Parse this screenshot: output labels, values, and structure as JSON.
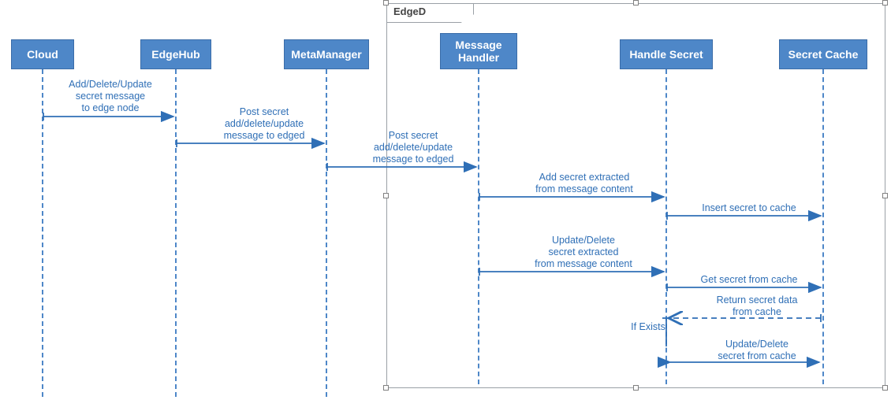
{
  "frame": {
    "label": "EdgeD"
  },
  "participants": {
    "cloud": {
      "label": "Cloud"
    },
    "edgehub": {
      "label": "EdgeHub"
    },
    "metamanager": {
      "label": "MetaManager"
    },
    "messagehandler": {
      "label": "Message\nHandler"
    },
    "handlesecret": {
      "label": "Handle Secret"
    },
    "secretcache": {
      "label": "Secret Cache"
    }
  },
  "messages": {
    "m1": "Add/Delete/Update\nsecret message\nto edge node",
    "m2": "Post secret\nadd/delete/update\nmessage to edged",
    "m3": "Post secret\nadd/delete/update\nmessage to edged",
    "m4": "Add secret extracted\nfrom message content",
    "m5": "Insert secret to cache",
    "m6": "Update/Delete\nsecret extracted\nfrom message content",
    "m7": "Get secret from cache",
    "m8": "Return secret data\nfrom cache",
    "m9": "If Exists",
    "m10": "Update/Delete\nsecret from cache"
  },
  "chart_data": {
    "type": "sequence-diagram",
    "frame": "EdgeD",
    "participants": [
      "Cloud",
      "EdgeHub",
      "MetaManager",
      "Message Handler",
      "Handle Secret",
      "Secret Cache"
    ],
    "frame_participants": [
      "Message Handler",
      "Handle Secret",
      "Secret Cache"
    ],
    "messages": [
      {
        "from": "Cloud",
        "to": "EdgeHub",
        "label": "Add/Delete/Update secret message to edge node",
        "style": "solid"
      },
      {
        "from": "EdgeHub",
        "to": "MetaManager",
        "label": "Post secret add/delete/update message to edged",
        "style": "solid"
      },
      {
        "from": "MetaManager",
        "to": "Message Handler",
        "label": "Post secret add/delete/update message to edged",
        "style": "solid"
      },
      {
        "from": "Message Handler",
        "to": "Handle Secret",
        "label": "Add secret extracted from message content",
        "style": "solid"
      },
      {
        "from": "Handle Secret",
        "to": "Secret Cache",
        "label": "Insert secret to cache",
        "style": "solid"
      },
      {
        "from": "Message Handler",
        "to": "Handle Secret",
        "label": "Update/Delete secret extracted from message content",
        "style": "solid"
      },
      {
        "from": "Handle Secret",
        "to": "Secret Cache",
        "label": "Get secret from cache",
        "style": "solid"
      },
      {
        "from": "Secret Cache",
        "to": "Handle Secret",
        "label": "Return secret data from cache",
        "style": "dashed"
      },
      {
        "from": "Handle Secret",
        "to": "Handle Secret",
        "label": "If Exists",
        "style": "segment"
      },
      {
        "from": "Handle Secret",
        "to": "Secret Cache",
        "label": "Update/Delete secret from cache",
        "style": "solid-biarrow"
      }
    ]
  }
}
